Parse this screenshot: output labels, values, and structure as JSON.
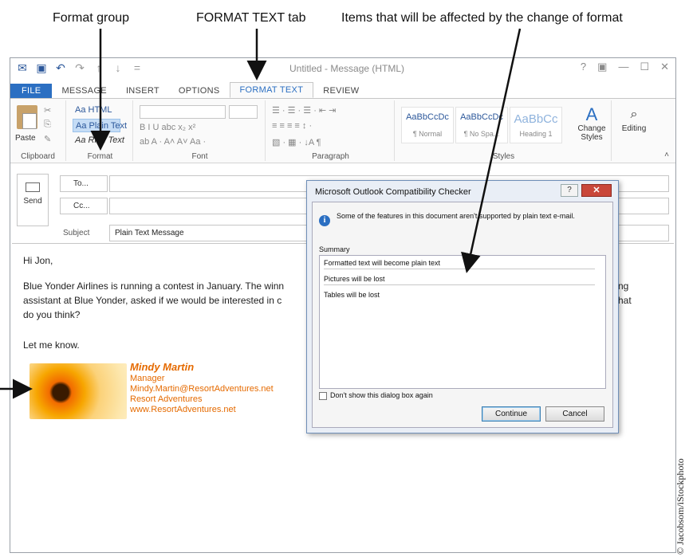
{
  "callouts": {
    "format_group": "Format group",
    "format_text_tab": "FORMAT TEXT tab",
    "items_affected": "Items that will be affected by the change of format"
  },
  "window": {
    "title": "Untitled - Message (HTML)",
    "qat_icons": [
      "envelope-icon",
      "save-icon",
      "undo-icon",
      "redo-icon",
      "up-arrow-icon",
      "down-arrow-icon",
      "customize-icon"
    ],
    "controls": [
      "?",
      "▣",
      "—",
      "☐",
      "✕"
    ]
  },
  "tabs": [
    "FILE",
    "MESSAGE",
    "INSERT",
    "OPTIONS",
    "FORMAT TEXT",
    "REVIEW"
  ],
  "ribbon": {
    "clipboard": {
      "paste": "Paste",
      "label": "Clipboard"
    },
    "format": {
      "html": "Aa HTML",
      "plain": "Aa Plain Text",
      "rich": "Aa Rich Text",
      "label": "Format"
    },
    "font": {
      "row1": "B  I  U  abc  x₂  x²   ",
      "row2": "ab  A  ·  A˄  A˅   Aa ·",
      "label": "Font"
    },
    "paragraph": {
      "row1": "☰ · ☰ · ☰ ·   ⇤ ⇥",
      "row2": "≡  ≡  ≡  ≡   ↕ ·",
      "row3": "▧ · ▦ ·   ↓A   ¶",
      "label": "Paragraph"
    },
    "styles": {
      "items": [
        {
          "sample": "AaBbCcDc",
          "name": "¶ Normal"
        },
        {
          "sample": "AaBbCcDc",
          "name": "¶ No Spa..."
        },
        {
          "sample": "AaBbCc",
          "name": "Heading 1"
        }
      ],
      "change_styles": "Change Styles",
      "label": "Styles"
    },
    "editing": {
      "label": "Editing"
    }
  },
  "compose": {
    "send": "Send",
    "to": "To...",
    "cc": "Cc...",
    "subject_label": "Subject",
    "subject": "Plain Text Message"
  },
  "body": {
    "greeting": "Hi Jon,",
    "para_line1_left": "Blue Yonder Airlines is running a contest in January. The winn",
    "para_line1_right": "ng",
    "para_line2_left": "assistant at Blue Yonder, asked if we would be interested in c",
    "para_line2_right": "hat",
    "para_line3": "do you think?",
    "closing": "Let me know.",
    "signature": {
      "name": "Mindy Martin",
      "title": "Manager",
      "email": "Mindy.Martin@ResortAdventures.net",
      "company": "Resort Adventures",
      "website": "www.ResortAdventures.net"
    }
  },
  "dialog": {
    "title": "Microsoft Outlook Compatibility Checker",
    "help": "?",
    "close": "✕",
    "message": "Some of the features in this document aren't supported by plain text e-mail.",
    "summary_label": "Summary",
    "items": [
      "Formatted text will become plain text",
      "Pictures will be lost",
      "Tables will be lost"
    ],
    "checkbox_label": "Don't show this dialog box again",
    "continue": "Continue",
    "cancel": "Cancel"
  },
  "credit": "© Jacobsom/iStockphoto"
}
